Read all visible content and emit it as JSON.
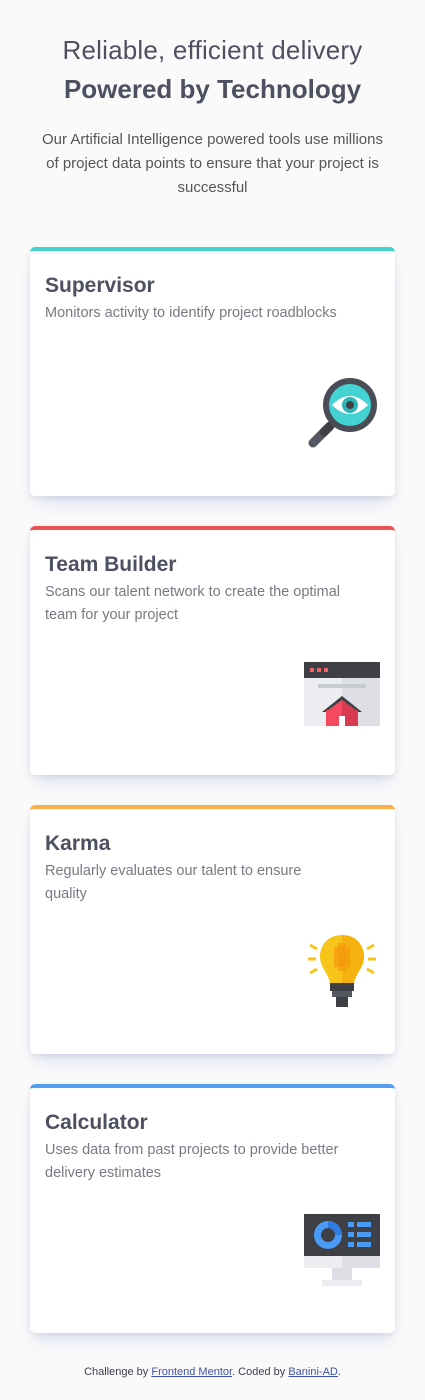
{
  "header": {
    "subtitle": "Reliable, efficient delivery",
    "title": "Powered by Technology",
    "description": "Our Artificial Intelligence powered tools use millions of project data points to ensure that your project is successful"
  },
  "cards": [
    {
      "title": "Supervisor",
      "text": "Monitors activity to identify project roadblocks",
      "accent": "#44d3d2",
      "icon": "magnifier-eye-icon"
    },
    {
      "title": "Team Builder",
      "text": "Scans our talent network to create the optimal team for your project",
      "accent": "#ea5454",
      "icon": "browser-home-icon"
    },
    {
      "title": "Karma",
      "text": "Regularly evaluates our talent to ensure quality",
      "accent": "#fcae4a",
      "icon": "lightbulb-icon"
    },
    {
      "title": "Calculator",
      "text": "Uses data from past projects to provide better delivery estimates",
      "accent": "#549ef2",
      "icon": "monitor-chart-icon"
    }
  ],
  "footer": {
    "prefix": "Challenge by ",
    "link1": "Frontend Mentor",
    "middle": ". Coded by ",
    "link2": "Banini-AD",
    "suffix": "."
  }
}
